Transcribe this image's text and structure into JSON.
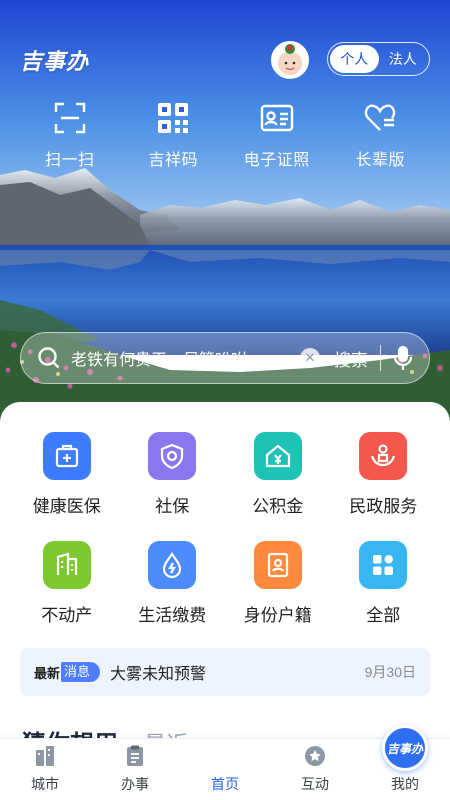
{
  "header": {
    "logo_text": "吉事办",
    "identity_tabs": [
      "个人",
      "法人"
    ]
  },
  "quick_actions": [
    {
      "label": "扫一扫",
      "icon": "scan-icon"
    },
    {
      "label": "吉祥码",
      "icon": "qr-code-icon"
    },
    {
      "label": "电子证照",
      "icon": "id-card-icon"
    },
    {
      "label": "长辈版",
      "icon": "heart-list-icon"
    }
  ],
  "search": {
    "placeholder": "老铁有何贵干，尽管吩咐",
    "button_label": "搜索"
  },
  "services": [
    {
      "label": "健康医保",
      "icon": "medical-kit-icon",
      "color": "#3d7bff"
    },
    {
      "label": "社保",
      "icon": "social-security-shield-icon",
      "color": "#8b78f0"
    },
    {
      "label": "公积金",
      "icon": "housing-fund-icon",
      "color": "#1fc3b5"
    },
    {
      "label": "民政服务",
      "icon": "civil-affairs-hands-icon",
      "color": "#f2584e"
    },
    {
      "label": "不动产",
      "icon": "building-icon",
      "color": "#7bc82f"
    },
    {
      "label": "生活缴费",
      "icon": "utility-drop-icon",
      "color": "#4d8cff"
    },
    {
      "label": "身份户籍",
      "icon": "id-book-icon",
      "color": "#ff8a3d"
    },
    {
      "label": "全部",
      "icon": "grid-all-icon",
      "color": "#38b6f2"
    }
  ],
  "news": {
    "tag_prefix": "最新",
    "tag_label": "消息",
    "text": "大雾未知预警",
    "date": "9月30日"
  },
  "section": {
    "title": "猜你想用",
    "alt_title": "最近"
  },
  "tabbar": [
    {
      "label": "城市",
      "icon": "city-icon"
    },
    {
      "label": "办事",
      "icon": "clipboard-icon"
    },
    {
      "label": "首页",
      "icon": "home-logo",
      "badge_text": "吉事办"
    },
    {
      "label": "互动",
      "icon": "star-bubble-icon"
    },
    {
      "label": "我的",
      "icon": "profile-icon"
    }
  ],
  "colors": {
    "accent": "#2563eb",
    "news_bg": "#eef4ff"
  }
}
